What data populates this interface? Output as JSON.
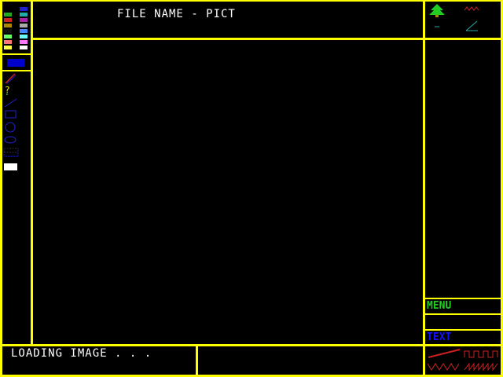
{
  "header": {
    "title": "FILE NAME - PICT"
  },
  "status": {
    "message": "LOADING IMAGE . . ."
  },
  "side_panel": {
    "menu_label": "MENU",
    "text_label": "TEXT"
  },
  "palette": {
    "left": [
      "#22aa22",
      "#cc2222",
      "#aa8800",
      "#111111",
      "#66ff66",
      "#ff7777",
      "#ffff44"
    ],
    "right": [
      "#2222cc",
      "#22aaaa",
      "#aa22aa",
      "#aaaaaa",
      "#4488ff",
      "#66ffff",
      "#ff77ff",
      "#ffffff"
    ]
  },
  "current_color": "#0000cc",
  "tools": [
    "pencil-tool",
    "spray-tool",
    "line-tool",
    "rectangle-tool",
    "circle-tool",
    "ellipse-tool",
    "fill-pattern-tool",
    "eraser-tool"
  ],
  "effects": [
    "tree-icon",
    "zigzag-icon",
    "dash-icon",
    "angle-icon",
    "red-line-icon",
    "square-wave-icon",
    "triangle-wave-icon",
    "sawtooth-wave-icon"
  ]
}
